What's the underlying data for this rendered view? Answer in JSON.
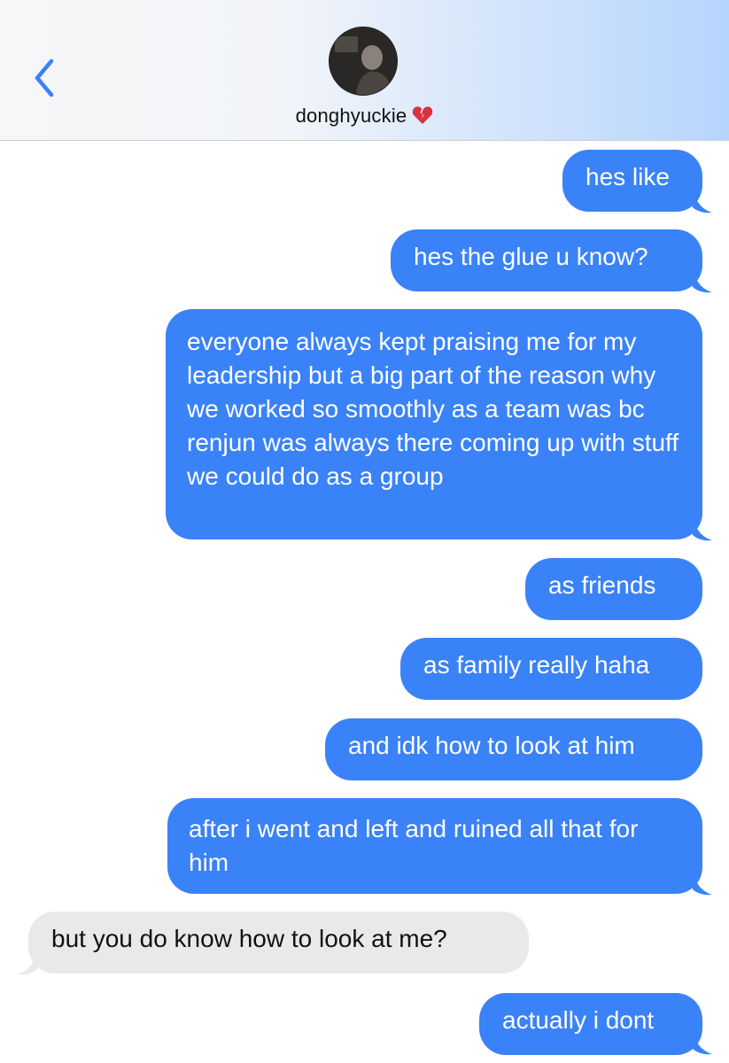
{
  "contact": {
    "name": "donghyuckie",
    "status_icon": "broken-heart-icon"
  },
  "colors": {
    "sent": "#3a82f7",
    "received": "#e9e9eb",
    "accent": "#3a82f7"
  },
  "messages": [
    {
      "from": "me",
      "text": "hes like"
    },
    {
      "from": "me",
      "text": "hes the glue u know?"
    },
    {
      "from": "me",
      "text": "everyone always kept praising me for my leadership but a big part of the reason why we worked so smoothly as a team was bc renjun was always there coming up with stuff we could do as a group"
    },
    {
      "from": "me",
      "text": "as friends"
    },
    {
      "from": "me",
      "text": "as family really haha"
    },
    {
      "from": "me",
      "text": "and idk how to look at him"
    },
    {
      "from": "me",
      "text": "after i went and left and ruined all that for him"
    },
    {
      "from": "them",
      "text": "but you do know how to look at me?"
    },
    {
      "from": "me",
      "text": "actually i dont"
    }
  ]
}
